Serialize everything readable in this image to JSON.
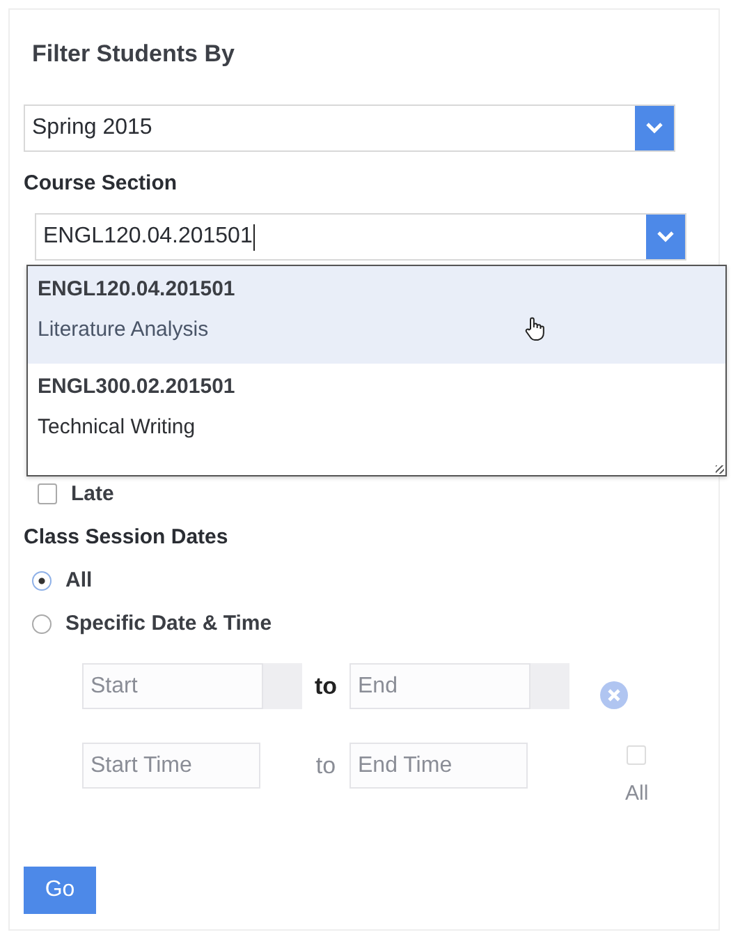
{
  "title": "Filter Students By",
  "term_select": {
    "value": "Spring 2015"
  },
  "course_section": {
    "label": "Course Section",
    "value": "ENGL120.04.201501",
    "focused": true,
    "options": [
      {
        "code": "ENGL120.04.201501",
        "name": "Literature Analysis",
        "selected": true
      },
      {
        "code": "ENGL300.02.201501",
        "name": "Technical Writing",
        "selected": false
      }
    ]
  },
  "late": {
    "label": "Late",
    "checked": false
  },
  "session_dates": {
    "label": "Class Session Dates",
    "options": [
      {
        "label": "All",
        "selected": true
      },
      {
        "label": "Specific Date & Time",
        "selected": false
      }
    ],
    "disabled": true,
    "rows": [
      {
        "kind": "date",
        "start_placeholder": "Start",
        "separator": "to",
        "separator_muted": false,
        "end_placeholder": "End"
      },
      {
        "kind": "time",
        "start_placeholder": "Start Time",
        "separator": "to",
        "separator_muted": true,
        "end_placeholder": "End Time",
        "all_label": "All",
        "all_checked": false
      }
    ]
  },
  "go_button": "Go"
}
